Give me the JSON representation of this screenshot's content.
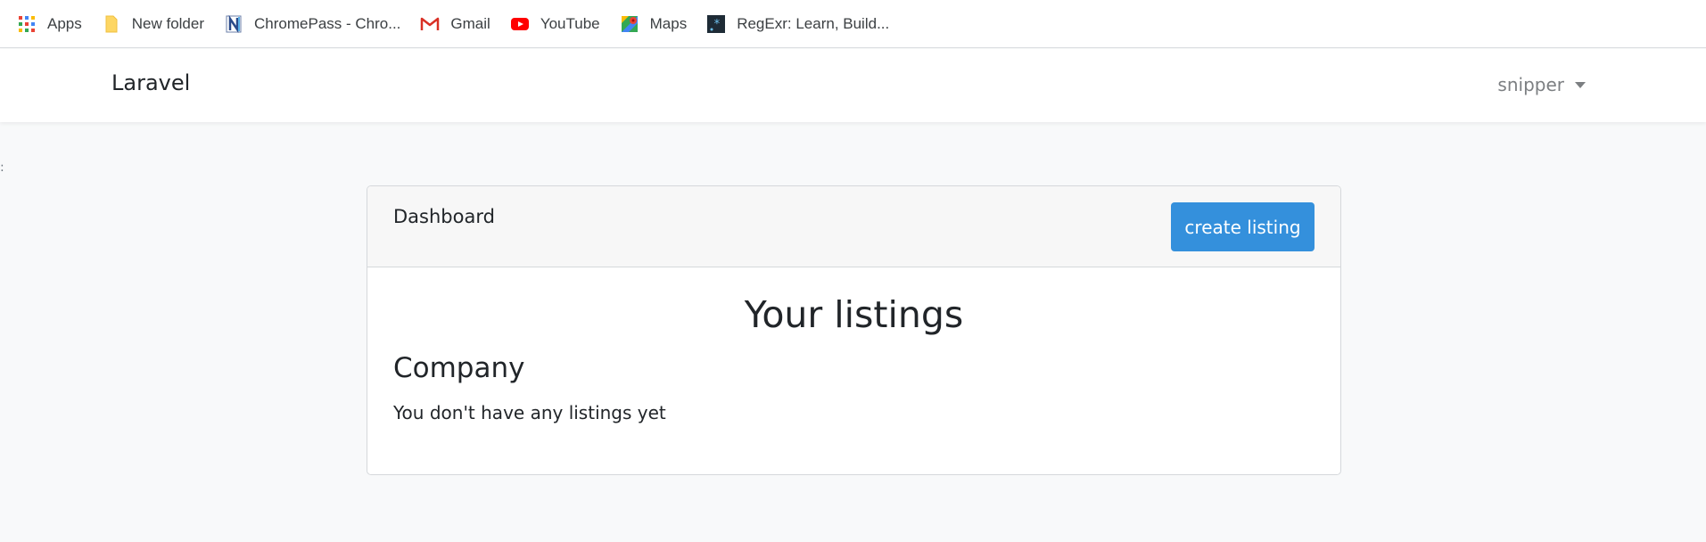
{
  "bookmarks": [
    {
      "label": "Apps",
      "icon": "apps-grid-icon"
    },
    {
      "label": "New folder",
      "icon": "folder-icon"
    },
    {
      "label": "ChromePass - Chro...",
      "icon": "chromepass-icon"
    },
    {
      "label": "Gmail",
      "icon": "gmail-icon"
    },
    {
      "label": "YouTube",
      "icon": "youtube-icon"
    },
    {
      "label": "Maps",
      "icon": "maps-icon"
    },
    {
      "label": "RegExr: Learn, Build...",
      "icon": "regexr-icon"
    }
  ],
  "navbar": {
    "brand": "Laravel",
    "user": "snipper"
  },
  "card": {
    "header_title": "Dashboard",
    "create_button": "create listing",
    "listings_title": "Your listings",
    "section_title": "Company",
    "empty_text": "You don't have any listings yet"
  },
  "colors": {
    "primary": "#3490dc",
    "page_bg": "#f8f9fa",
    "card_header_bg": "#f7f7f7"
  }
}
